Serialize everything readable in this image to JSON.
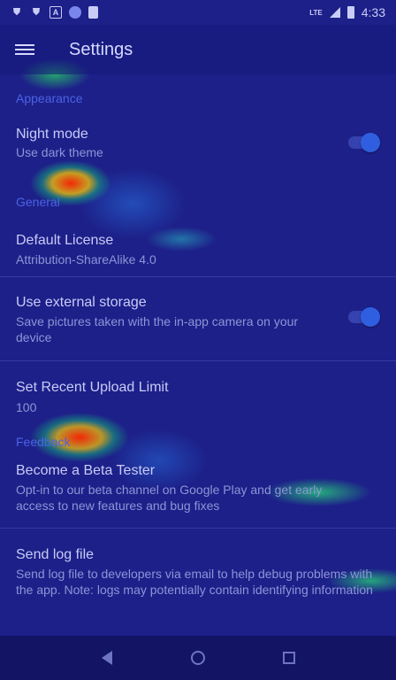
{
  "status_bar": {
    "time": "4:33",
    "network": "LTE",
    "left_icons": [
      "shield-icon",
      "shield-icon",
      "a-icon",
      "circle-icon",
      "sd-card-icon"
    ]
  },
  "app_bar": {
    "title": "Settings"
  },
  "sections": {
    "appearance": "Appearance",
    "general": "General",
    "feedback": "Feedback"
  },
  "prefs": {
    "night_mode": {
      "title": "Night mode",
      "summary": "Use dark theme",
      "enabled": true
    },
    "default_license": {
      "title": "Default License",
      "summary": "Attribution-ShareAlike 4.0"
    },
    "external_storage": {
      "title": "Use external storage",
      "summary": "Save pictures taken with the in-app camera on your device",
      "enabled": true
    },
    "upload_limit": {
      "title": "Set Recent Upload Limit",
      "summary": "100"
    },
    "beta_tester": {
      "title": "Become a Beta Tester",
      "summary": "Opt-in to our beta channel on Google Play and get early access to new features and bug fixes"
    },
    "send_log": {
      "title": "Send log file",
      "summary": "Send log file to developers via email to help debug problems with the app. Note: logs may potentially contain identifying information"
    }
  },
  "colors": {
    "accent": "#2f5fe0",
    "section": "#4b62e6"
  }
}
